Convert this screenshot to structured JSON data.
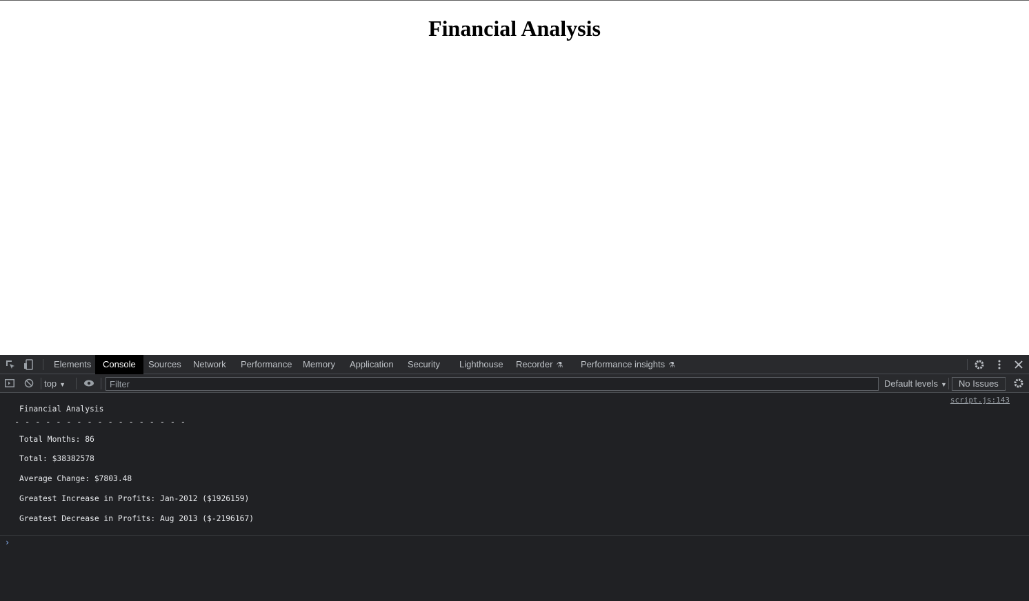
{
  "page": {
    "title": "Financial Analysis"
  },
  "devtools": {
    "tabs": [
      {
        "label": "Elements"
      },
      {
        "label": "Console"
      },
      {
        "label": "Sources"
      },
      {
        "label": "Network"
      },
      {
        "label": "Performance"
      },
      {
        "label": "Memory"
      },
      {
        "label": "Application"
      },
      {
        "label": "Security"
      },
      {
        "label": "Lighthouse"
      },
      {
        "label": "Recorder"
      },
      {
        "label": "Performance insights"
      }
    ],
    "active_tab": "Console",
    "toolbar": {
      "context": "top",
      "filter_placeholder": "Filter",
      "levels": "Default levels",
      "issues": "No Issues"
    },
    "console": {
      "source": "script.js:143",
      "lines": [
        "Financial Analysis",
        "- - - - - - - - - - - - - - - - -",
        "Total Months: 86",
        "Total: $38382578",
        "Average Change: $7803.48",
        "Greatest Increase in Profits: Jan-2012 ($1926159)",
        "Greatest Decrease in Profits: Aug 2013 ($-2196167)"
      ],
      "prompt": "›"
    }
  },
  "colors": {
    "devtools_bg": "#202124",
    "toolbar_bg": "#292a2d",
    "active_tab_bg": "#000000",
    "prompt": "#8ab4f8"
  }
}
